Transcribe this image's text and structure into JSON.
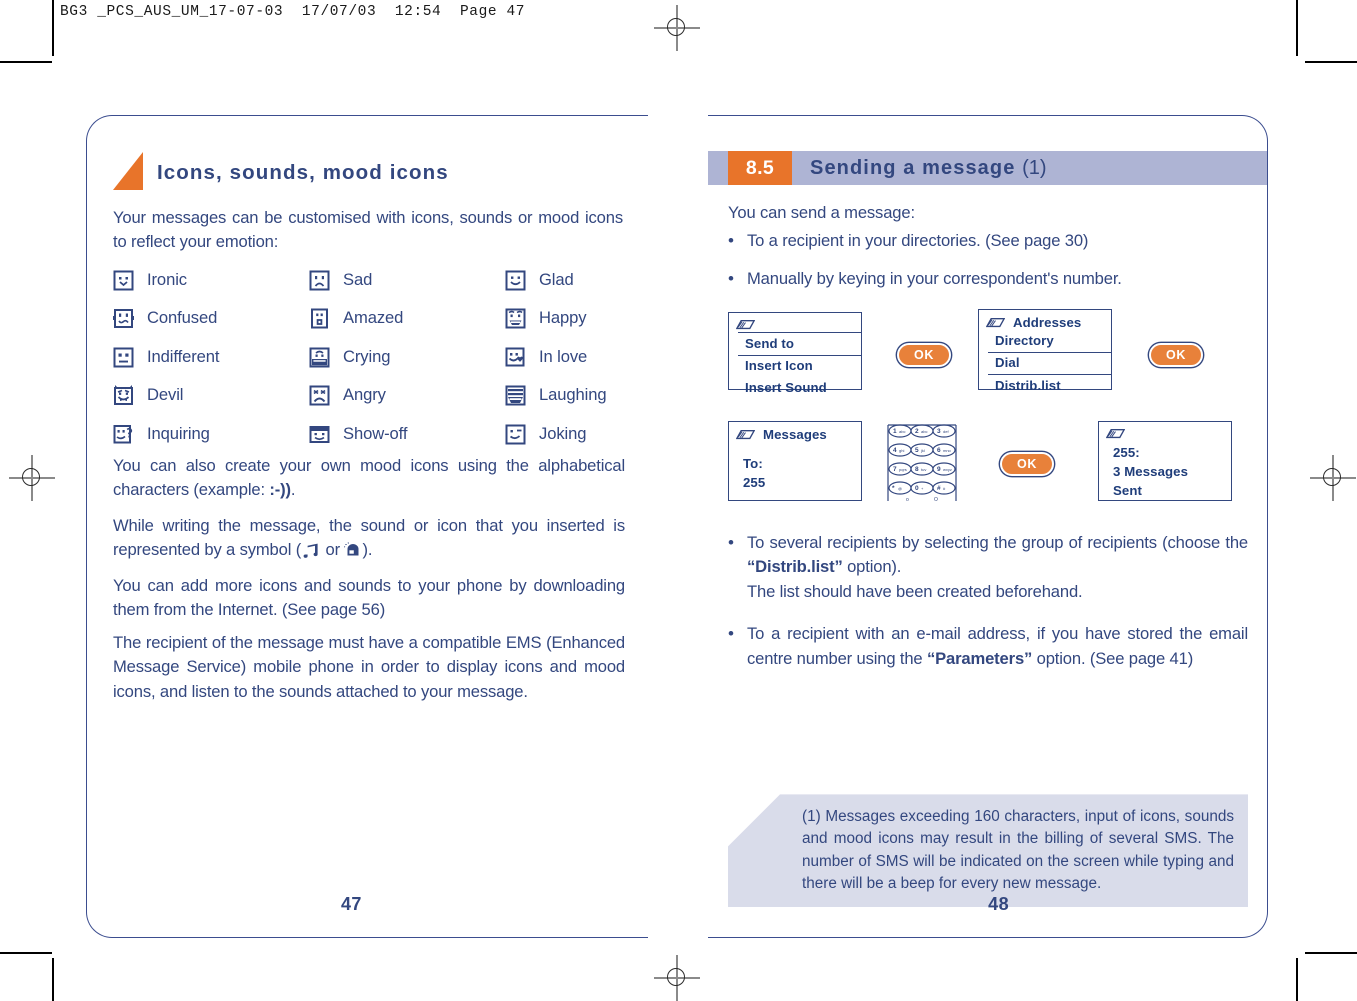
{
  "slug": "BG3 _PCS_AUS_UM_17-07-03  17/07/03  12:54  Page 47",
  "colors": {
    "ink": "#33477f",
    "accent_orange": "#e8742a",
    "bar_lilac": "#aeb4d4",
    "footnote_bg": "#d9dcea"
  },
  "left_page": {
    "page_number": "47",
    "flag_icon": "orange-triangle-icon",
    "title": "Icons, sounds, mood icons",
    "intro": "Your messages can be customised with icons, sounds or mood icons to reflect your emotion:",
    "mood_icons": [
      {
        "icon": "ironic-face-icon",
        "label": "Ironic"
      },
      {
        "icon": "sad-face-icon",
        "label": "Sad"
      },
      {
        "icon": "glad-face-icon",
        "label": "Glad"
      },
      {
        "icon": "confused-face-icon",
        "label": "Confused"
      },
      {
        "icon": "amazed-face-icon",
        "label": "Amazed"
      },
      {
        "icon": "happy-face-icon",
        "label": "Happy"
      },
      {
        "icon": "indifferent-face-icon",
        "label": "Indifferent"
      },
      {
        "icon": "crying-face-icon",
        "label": "Crying"
      },
      {
        "icon": "in-love-face-icon",
        "label": "In love"
      },
      {
        "icon": "devil-face-icon",
        "label": "Devil"
      },
      {
        "icon": "angry-face-icon",
        "label": "Angry"
      },
      {
        "icon": "laughing-face-icon",
        "label": "Laughing"
      },
      {
        "icon": "inquiring-face-icon",
        "label": "Inquiring"
      },
      {
        "icon": "show-off-face-icon",
        "label": "Show-off"
      },
      {
        "icon": "joking-face-icon",
        "label": "Joking"
      }
    ],
    "para_create_a": "You can also create your own mood icons using the alphabetical characters (example: ",
    "para_create_emoticon": ":-))",
    "para_create_b": ".",
    "para_while_a": "While writing the message, the sound or icon that you inserted is represented by a symbol (",
    "para_while_b": " or ",
    "para_while_c": ").",
    "para_add": "You can add more icons and sounds to your phone by downloading them from the Internet. (See page 56)",
    "para_recipient": "The recipient of the message must have a compatible EMS (Enhanced Message Service) mobile phone in order to display icons  and mood icons, and listen to the sounds attached to your message."
  },
  "right_page": {
    "page_number": "48",
    "section_number": "8.5",
    "section_title": "Sending a message",
    "section_title_note": "(1)",
    "lead": "You can send a message:",
    "bullets_top": [
      "To a recipient in your directories. (See page 30)",
      "Manually by keying in your correspondent's number."
    ],
    "diagram": {
      "screen_1": {
        "header_icon": "envelope-icon",
        "header_title": "",
        "rows": [
          {
            "label": "Send to",
            "selected": true
          },
          {
            "label": "Insert Icon",
            "selected": false
          },
          {
            "label": "Insert Sound",
            "selected": false
          }
        ]
      },
      "ok_button_1": "OK",
      "screen_2": {
        "header_icon": "envelope-icon",
        "header_title": "Addresses",
        "rows": [
          {
            "label": "Directory",
            "selected": false
          },
          {
            "label": "Dial",
            "selected": true
          },
          {
            "label": "Distrib.list",
            "selected": false
          }
        ]
      },
      "ok_button_2": "OK",
      "screen_3": {
        "header_icon": "envelope-icon",
        "header_title": "Messages",
        "lines": [
          "To:",
          "255"
        ]
      },
      "keypad_icon": "phone-keypad-icon",
      "ok_button_3": "OK",
      "screen_4": {
        "header_icon": "envelope-icon",
        "lines": [
          "255:",
          "3 Messages",
          "Sent"
        ]
      }
    },
    "bullets_bottom": [
      {
        "text_a": "To several recipients by selecting the group of recipients (choose the ",
        "bold": "“Distrib.list”",
        "text_b": " option).",
        "text_c": "The list should have been created beforehand."
      },
      {
        "text_a": "To a recipient with an e-mail address, if you have stored the email centre number using the ",
        "bold": "“Parameters”",
        "text_b": " option. (See page 41)"
      }
    ],
    "footnote": {
      "mark_icon": "exclamation-icon",
      "number": "(1)",
      "text": "Messages exceeding 160 characters, input of icons, sounds and mood icons may result in the billing of several SMS. The number of SMS will be indicated on the screen while typing and there will be a beep for every new message."
    }
  }
}
